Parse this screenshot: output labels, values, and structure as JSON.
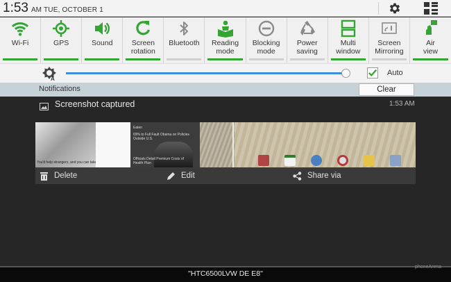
{
  "status_bar": {
    "time": "1:53",
    "ampm": "AM",
    "date": "TUE, OCTOBER 1",
    "icons": [
      "gear-icon",
      "apps-grid-icon"
    ]
  },
  "quick_settings": {
    "accent_on": "#33a532",
    "items": [
      {
        "label": "Wi-Fi",
        "icon": "wifi-icon",
        "on": true
      },
      {
        "label": "GPS",
        "icon": "gps-icon",
        "on": true
      },
      {
        "label": "Sound",
        "icon": "sound-icon",
        "on": true
      },
      {
        "label": "Screen\nrotation",
        "icon": "rotation-icon",
        "on": true
      },
      {
        "label": "Bluetooth",
        "icon": "bluetooth-icon",
        "on": false
      },
      {
        "label": "Reading\nmode",
        "icon": "reading-mode-icon",
        "on": true
      },
      {
        "label": "Blocking\nmode",
        "icon": "blocking-mode-icon",
        "on": false
      },
      {
        "label": "Power\nsaving",
        "icon": "power-saving-icon",
        "on": false
      },
      {
        "label": "Multi\nwindow",
        "icon": "multi-window-icon",
        "on": true
      },
      {
        "label": "Screen\nMirroring",
        "icon": "screen-mirroring-icon",
        "on": false
      },
      {
        "label": "Air\nview",
        "icon": "air-view-icon",
        "on": true
      }
    ]
  },
  "brightness": {
    "level": 0.98,
    "auto_label": "Auto",
    "auto_checked": true
  },
  "notifications": {
    "header": "Notifications",
    "clear_label": "Clear",
    "item": {
      "title": "Screenshot captured",
      "time": "1:53 AM",
      "preview_texts": {
        "caption_left": "You'd help strangers, and you can take care of you.",
        "news_heading": "Eaten",
        "news_line1": "69% to Full Fault Obama on Policies Outside U.S.",
        "news_line2": "Officials Detail Premium Costs of Health Plan"
      },
      "actions": [
        {
          "label": "Delete",
          "icon": "trash-icon"
        },
        {
          "label": "Edit",
          "icon": "pencil-icon"
        },
        {
          "label": "Share via",
          "icon": "share-icon"
        }
      ]
    }
  },
  "bottom_bar": {
    "label": "\"HTC6500LVW DE E8\""
  },
  "watermark": "phoneArena"
}
